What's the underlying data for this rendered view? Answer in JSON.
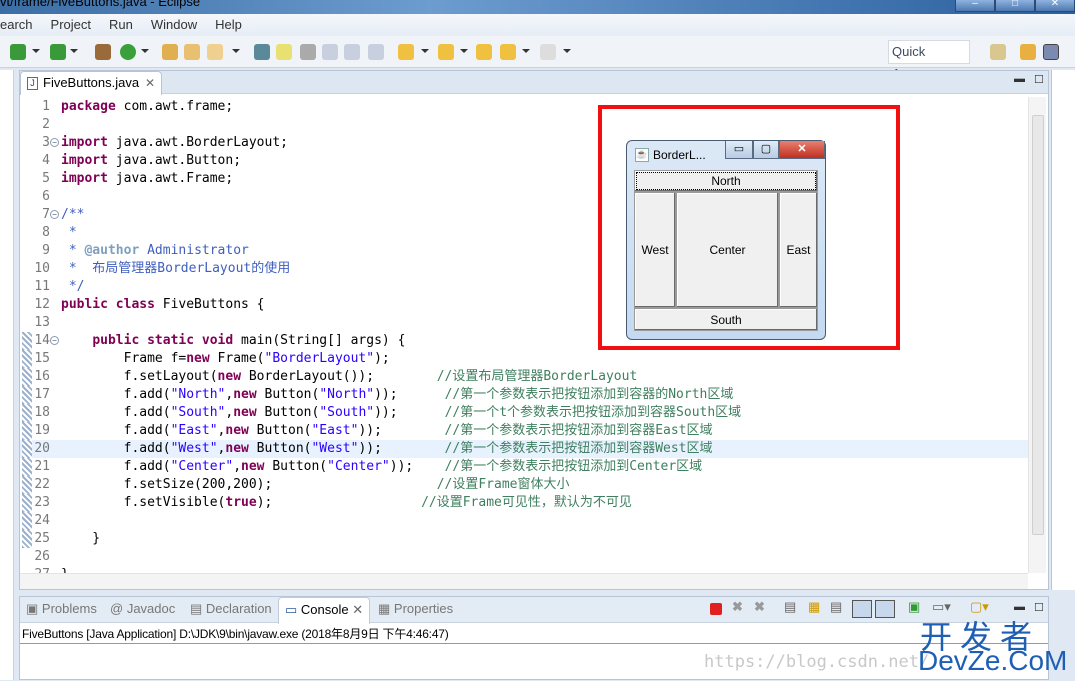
{
  "window": {
    "title": "vt/frame/FiveButtons.java - Eclipse"
  },
  "menu": [
    "earch",
    "Project",
    "Run",
    "Window",
    "Help"
  ],
  "toolbar": {
    "quick_access": "Quick Access"
  },
  "editor": {
    "tab_label": "FiveButtons.java",
    "highlighted_line": 20,
    "lines": [
      {
        "n": "1",
        "t": [
          [
            "k",
            "package"
          ],
          [
            "p",
            " com.awt.frame;"
          ]
        ]
      },
      {
        "n": "2",
        "t": []
      },
      {
        "n": "3",
        "fold": true,
        "t": [
          [
            "k",
            "import"
          ],
          [
            "p",
            " java.awt.BorderLayout;"
          ]
        ]
      },
      {
        "n": "4",
        "t": [
          [
            "k",
            "import"
          ],
          [
            "p",
            " java.awt.Button;"
          ]
        ]
      },
      {
        "n": "5",
        "t": [
          [
            "k",
            "import"
          ],
          [
            "p",
            " java.awt.Frame;"
          ]
        ]
      },
      {
        "n": "6",
        "t": []
      },
      {
        "n": "7",
        "fold": true,
        "t": [
          [
            "d",
            "/**"
          ]
        ]
      },
      {
        "n": "8",
        "t": [
          [
            "d",
            " *"
          ]
        ]
      },
      {
        "n": "9",
        "t": [
          [
            "d",
            " * "
          ],
          [
            "a",
            "@author"
          ],
          [
            "d",
            " Administrator"
          ]
        ]
      },
      {
        "n": "10",
        "t": [
          [
            "d",
            " *  布局管理器BorderLayout的使用"
          ]
        ]
      },
      {
        "n": "11",
        "t": [
          [
            "d",
            " */"
          ]
        ]
      },
      {
        "n": "12",
        "t": [
          [
            "k",
            "public class"
          ],
          [
            "p",
            " FiveButtons {"
          ]
        ]
      },
      {
        "n": "13",
        "t": []
      },
      {
        "n": "14",
        "fold": true,
        "ruler": true,
        "t": [
          [
            "p",
            "    "
          ],
          [
            "k",
            "public static void"
          ],
          [
            "p",
            " main(String[] args) {"
          ]
        ]
      },
      {
        "n": "15",
        "ruler": true,
        "t": [
          [
            "p",
            "        Frame f="
          ],
          [
            "k",
            "new"
          ],
          [
            "p",
            " Frame("
          ],
          [
            "s",
            "\"BorderLayout\""
          ],
          [
            "p",
            ");"
          ]
        ]
      },
      {
        "n": "16",
        "ruler": true,
        "t": [
          [
            "p",
            "        f.setLayout("
          ],
          [
            "k",
            "new"
          ],
          [
            "p",
            " BorderLayout());        "
          ],
          [
            "c",
            "//设置布局管理器BorderLayout"
          ]
        ]
      },
      {
        "n": "17",
        "ruler": true,
        "t": [
          [
            "p",
            "        f.add("
          ],
          [
            "s",
            "\"North\""
          ],
          [
            "p",
            ","
          ],
          [
            "k",
            "new"
          ],
          [
            "p",
            " Button("
          ],
          [
            "s",
            "\"North\""
          ],
          [
            "p",
            "));      "
          ],
          [
            "c",
            "//第一个参数表示把按钮添加到容器的North区域"
          ]
        ]
      },
      {
        "n": "18",
        "ruler": true,
        "t": [
          [
            "p",
            "        f.add("
          ],
          [
            "s",
            "\"South\""
          ],
          [
            "p",
            ","
          ],
          [
            "k",
            "new"
          ],
          [
            "p",
            " Button("
          ],
          [
            "s",
            "\"South\""
          ],
          [
            "p",
            "));      "
          ],
          [
            "c",
            "//第一个t个参数表示把按钮添加到容器South区域"
          ]
        ]
      },
      {
        "n": "19",
        "ruler": true,
        "t": [
          [
            "p",
            "        f.add("
          ],
          [
            "s",
            "\"East\""
          ],
          [
            "p",
            ","
          ],
          [
            "k",
            "new"
          ],
          [
            "p",
            " Button("
          ],
          [
            "s",
            "\"East\""
          ],
          [
            "p",
            "));        "
          ],
          [
            "c",
            "//第一个参数表示把按钮添加到容器East区域"
          ]
        ]
      },
      {
        "n": "20",
        "ruler": true,
        "t": [
          [
            "p",
            "        f.add("
          ],
          [
            "s",
            "\"West\""
          ],
          [
            "p",
            ","
          ],
          [
            "k",
            "new"
          ],
          [
            "p",
            " Button("
          ],
          [
            "s",
            "\"West\""
          ],
          [
            "p",
            "));        "
          ],
          [
            "c",
            "//第一个参数表示把按钮添加到容器West区域"
          ]
        ]
      },
      {
        "n": "21",
        "ruler": true,
        "t": [
          [
            "p",
            "        f.add("
          ],
          [
            "s",
            "\"Center\""
          ],
          [
            "p",
            ","
          ],
          [
            "k",
            "new"
          ],
          [
            "p",
            " Button("
          ],
          [
            "s",
            "\"Center\""
          ],
          [
            "p",
            "));    "
          ],
          [
            "c",
            "//第一个参数表示把按钮添加到Center区域"
          ]
        ]
      },
      {
        "n": "22",
        "ruler": true,
        "t": [
          [
            "p",
            "        f.setSize(200,200);                     "
          ],
          [
            "c",
            "//设置Frame窗体大小"
          ]
        ]
      },
      {
        "n": "23",
        "ruler": true,
        "t": [
          [
            "p",
            "        f.setVisible("
          ],
          [
            "k",
            "true"
          ],
          [
            "p",
            ");                   "
          ],
          [
            "c",
            "//设置Frame可见性，默认为不可见"
          ]
        ]
      },
      {
        "n": "24",
        "ruler": true,
        "t": []
      },
      {
        "n": "25",
        "ruler": true,
        "t": [
          [
            "p",
            "    }"
          ]
        ]
      },
      {
        "n": "26",
        "t": []
      },
      {
        "n": "27",
        "t": [
          [
            "p",
            "}"
          ]
        ]
      }
    ]
  },
  "awt_window": {
    "title": "BorderL...",
    "north": "North",
    "south": "South",
    "east": "East",
    "west": "West",
    "center": "Center"
  },
  "bottom": {
    "tabs": [
      "Problems",
      "Javadoc",
      "Declaration",
      "Console",
      "Properties"
    ],
    "active_tab": "Console",
    "console_line": "FiveButtons [Java Application] D:\\JDK\\9\\bin\\javaw.exe (2018年8月9日 下午4:46:47)"
  },
  "watermark": {
    "cn": "开发者",
    "en": "DevZe.CoM",
    "url": "https://blog.csdn.net/"
  },
  "colors": {
    "keyword": "#7f0055",
    "string": "#2a00ff",
    "comment": "#3f7f5f",
    "javadoc": "#3f5fbf",
    "highlight": "#e8f2fe",
    "annotation_box": "#f01010"
  }
}
